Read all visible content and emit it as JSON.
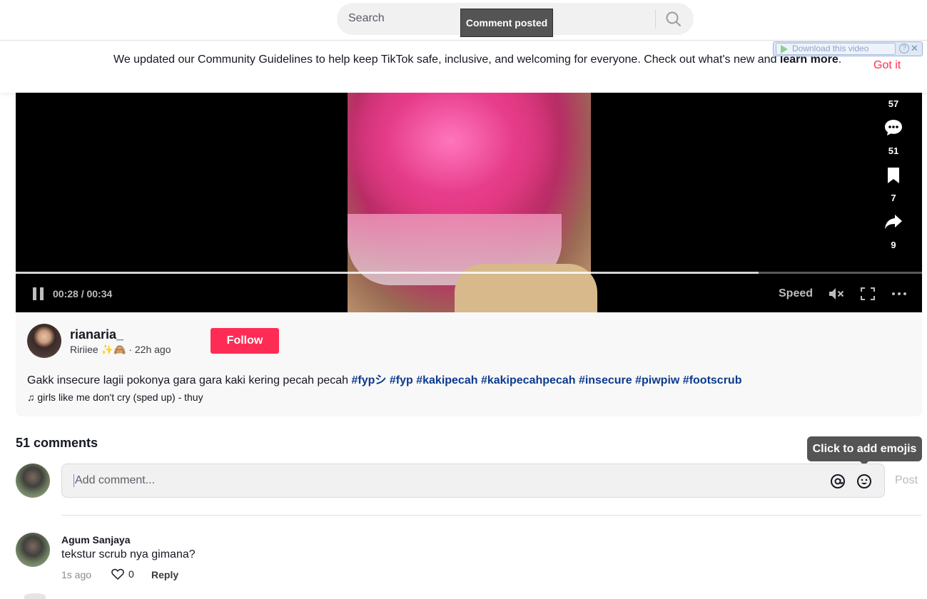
{
  "search": {
    "placeholder": "Search"
  },
  "toast": {
    "text": "Comment posted"
  },
  "notice": {
    "text": "We updated our Community Guidelines to help keep TikTok safe, inclusive, and welcoming for everyone. Check out what's new and ",
    "link": "learn more",
    "period": ".",
    "dismiss": "Got it"
  },
  "download_bar": {
    "label": "Download this video",
    "help": "?",
    "close": "✕"
  },
  "player": {
    "time": "00:28 / 00:34",
    "speed": "Speed",
    "progress_fraction": 0.82,
    "actions": [
      {
        "icon": "heart-icon",
        "count": "57"
      },
      {
        "icon": "comment-icon",
        "count": "51"
      },
      {
        "icon": "bookmark-icon",
        "count": "7"
      },
      {
        "icon": "share-icon",
        "count": "9"
      }
    ]
  },
  "post": {
    "username": "rianaria_",
    "nickname": "Ririiee ✨🙈",
    "time_ago": "· 22h ago",
    "follow": "Follow",
    "caption": "Gakk insecure lagii pokonya gara gara kaki kering pecah pecah ",
    "hashtags": [
      "#fypシ",
      "#fyp",
      "#kakipecah",
      "#kakipecahpecah",
      "#insecure",
      "#piwpiw",
      "#footscrub"
    ],
    "music": "girls like me don't cry (sped up) - thuy"
  },
  "comments": {
    "title": "51 comments",
    "tooltip": "Click to add emojis",
    "input_placeholder": "Add comment...",
    "post": "Post",
    "items": [
      {
        "name": "Agum Sanjaya",
        "text": "tekstur scrub nya gimana?",
        "time": "1s ago",
        "likes": "0",
        "reply": "Reply"
      }
    ]
  }
}
